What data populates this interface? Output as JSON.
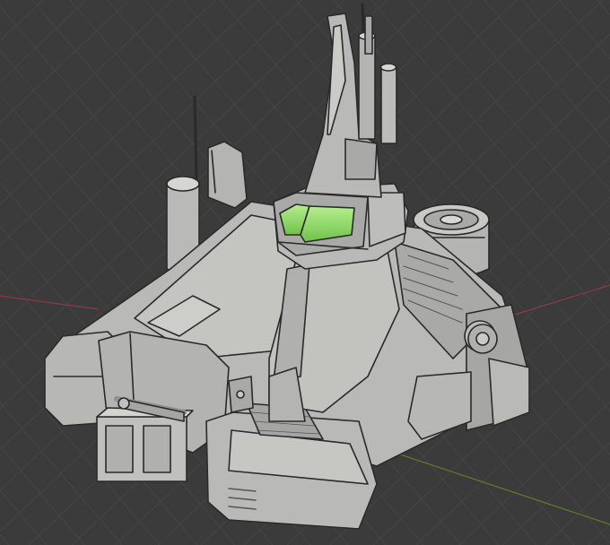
{
  "viewport": {
    "background_color": "#3b3b3b",
    "grid_color": "#444444",
    "x_axis_color": "#8a3b44",
    "y_axis_color": "#5d7a2a"
  },
  "model": {
    "body_color": "#b9b9b7",
    "shadow_color": "#8f8f8d",
    "highlight_color": "#d6d6d3",
    "outline_color": "#2a2a2a",
    "cockpit_glass_color": "#8fd86a"
  }
}
